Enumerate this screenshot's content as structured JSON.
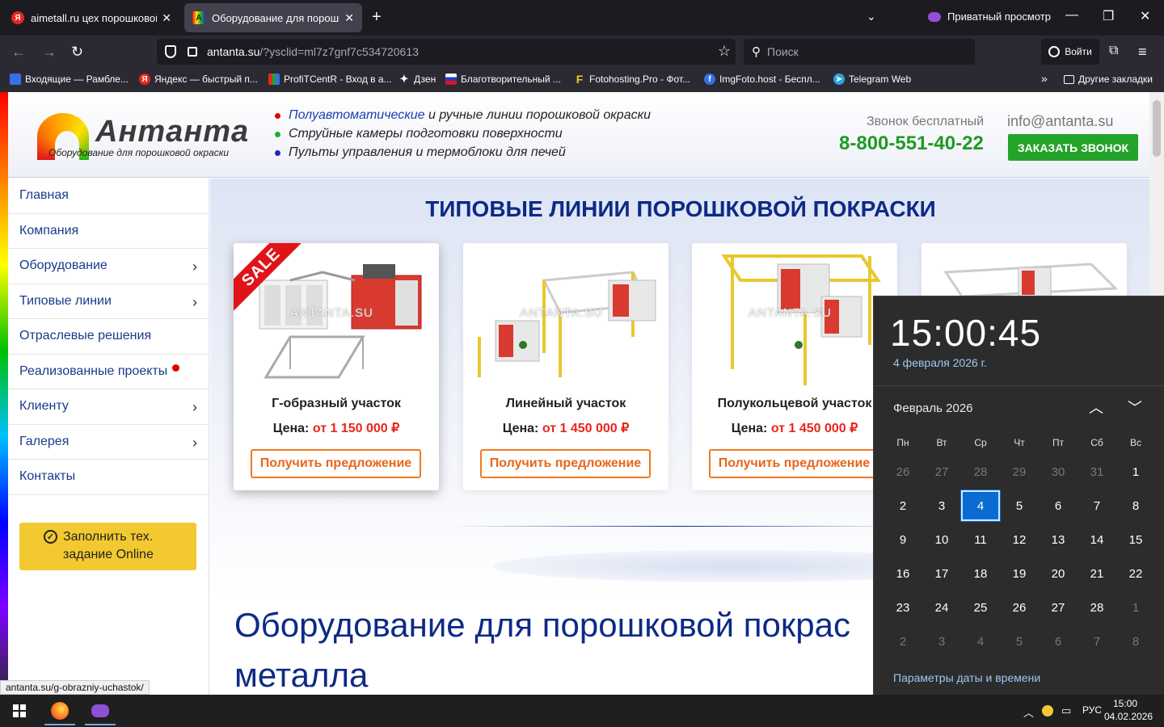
{
  "browser": {
    "tabs": [
      {
        "title": "aimetall.ru цех порошковой по",
        "active": false,
        "favicon": "yandex-icon"
      },
      {
        "title": "Оборудование для порошково",
        "active": true,
        "favicon": "antanta-icon"
      }
    ],
    "private_label": "Приватный просмотр",
    "url_domain": "antanta.su",
    "url_rest": "/?ysclid=ml7z7gnf7c534720613",
    "search_placeholder": "Поиск",
    "login_label": "Войти",
    "bookmarks": [
      {
        "label": "Входящие — Рамбле...",
        "icon": "mail-icon"
      },
      {
        "label": "Яндекс — быстрый п...",
        "icon": "yandex-icon"
      },
      {
        "label": "ProfiTCentR - Вход в а...",
        "icon": "chart-icon"
      },
      {
        "label": "Дзен",
        "icon": "zen-icon"
      },
      {
        "label": "Благотворительный ...",
        "icon": "flag-icon"
      },
      {
        "label": "Fotohosting.Pro - Фот...",
        "icon": "f-icon"
      },
      {
        "label": "ImgFoto.host - Беспл...",
        "icon": "imgfoto-icon"
      },
      {
        "label": "Telegram Web",
        "icon": "telegram-icon"
      }
    ],
    "other_bookmarks": "Другие закладки"
  },
  "site": {
    "logo_name": "Антанта",
    "logo_sub": "Оборудование для порошковой окраски",
    "bullets": {
      "b1_hl": "Полуавтоматические",
      "b1_rest": " и ручные линии порошковой окраски",
      "b2": "Струйные камеры подготовки поверхности",
      "b3": "Пульты управления и термоблоки для печей"
    },
    "freecall": "Звонок бесплатный",
    "phone": "8-800-551-40-22",
    "email": "info@antanta.su",
    "callback": "ЗАКАЗАТЬ ЗВОНОК",
    "menu": [
      {
        "label": "Главная"
      },
      {
        "label": "Компания"
      },
      {
        "label": "Оборудование"
      },
      {
        "label": "Типовые линии"
      },
      {
        "label": "Отраслевые решения"
      },
      {
        "label": "Реализованные проекты"
      },
      {
        "label": "Клиенту"
      },
      {
        "label": "Галерея"
      },
      {
        "label": "Контакты"
      }
    ],
    "fill_btn": {
      "line1": "Заполнить тех.",
      "line2": "задание Online"
    },
    "section_title": "ТИПОВЫЕ ЛИНИИ ПОРОШКОВОЙ ПОКРАСКИ",
    "sale_label": "SALE",
    "watermark": "ANTANTA.SU",
    "price_label": "Цена: ",
    "offer_label": "Получить предложение",
    "cards": [
      {
        "name": "Г-образный участок",
        "price": "от 1 150 000 ₽"
      },
      {
        "name": "Линейный участок",
        "price": "от 1 450 000 ₽"
      },
      {
        "name": "Полукольцевой участок",
        "price": "от 1 450 000 ₽"
      }
    ],
    "big_title_1": "Оборудование для порошковой покрас",
    "big_title_2": "металла"
  },
  "status_url": "antanta.su/g-obrazniy-uchastok/",
  "calendar": {
    "time": "15:00:45",
    "date": "4 февраля 2026 г.",
    "month": "Февраль 2026",
    "weekdays": [
      "Пн",
      "Вт",
      "Ср",
      "Чт",
      "Пт",
      "Сб",
      "Вс"
    ],
    "weeks": [
      [
        "26",
        "27",
        "28",
        "29",
        "30",
        "31",
        "1"
      ],
      [
        "2",
        "3",
        "4",
        "5",
        "6",
        "7",
        "8"
      ],
      [
        "9",
        "10",
        "11",
        "12",
        "13",
        "14",
        "15"
      ],
      [
        "16",
        "17",
        "18",
        "19",
        "20",
        "21",
        "22"
      ],
      [
        "23",
        "24",
        "25",
        "26",
        "27",
        "28",
        "1"
      ],
      [
        "2",
        "3",
        "4",
        "5",
        "6",
        "7",
        "8"
      ]
    ],
    "settings_link": "Параметры даты и времени"
  },
  "taskbar": {
    "lang": "РУС",
    "time": "15:00",
    "date": "04.02.2026"
  },
  "colors": {
    "brand_blue": "#0d2a86",
    "green": "#24a32a",
    "orange": "#f07a20",
    "red": "#e8261c",
    "accent_calendar": "#0a6cd0"
  }
}
